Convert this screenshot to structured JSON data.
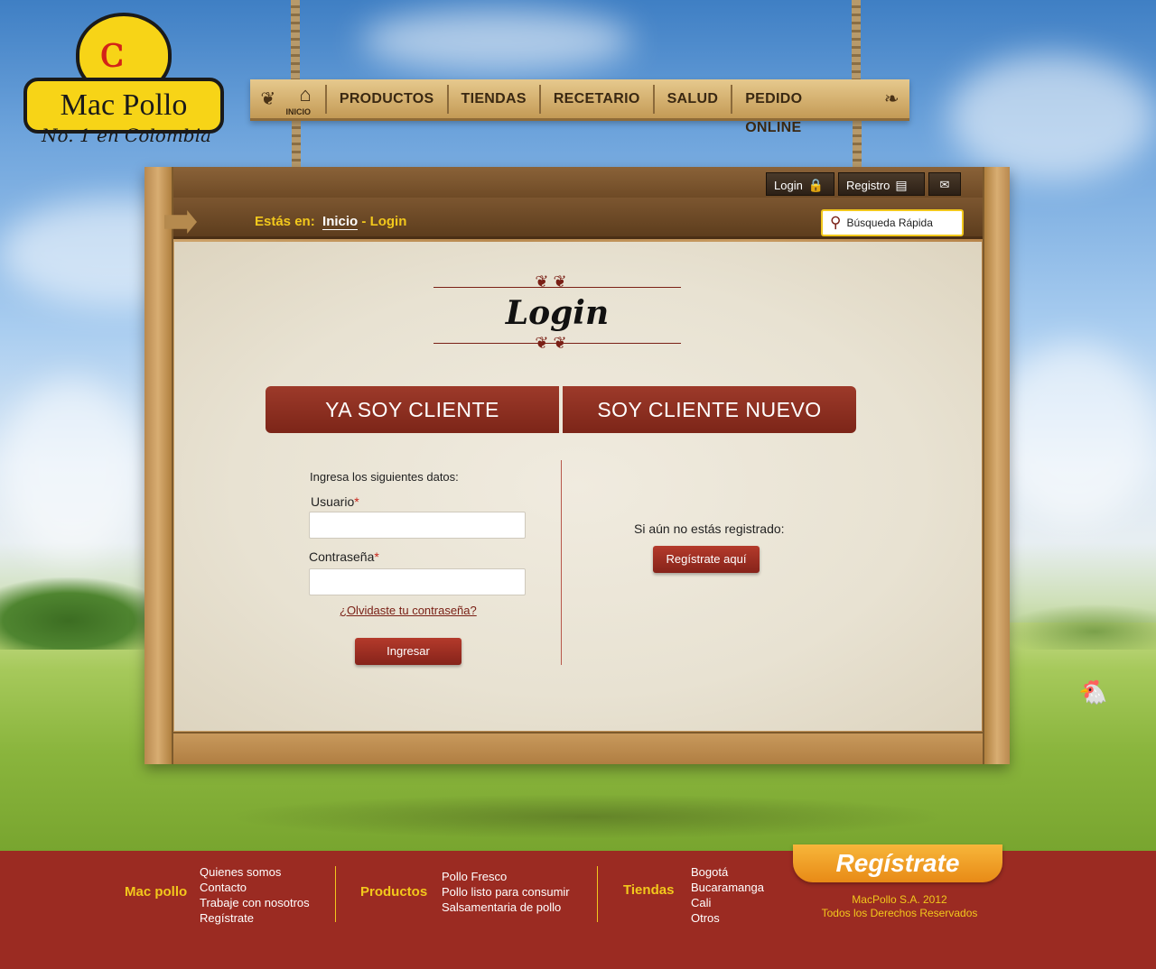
{
  "brand": {
    "name": "Mac Pollo",
    "tagline": "No. 1 en Colombia"
  },
  "nav": {
    "home_label": "INICIO",
    "items": [
      "PRODUCTOS",
      "TIENDAS",
      "RECETARIO",
      "SALUD",
      "PEDIDO ONLINE"
    ]
  },
  "topbar": {
    "login": "Login",
    "registro": "Registro"
  },
  "breadcrumb": {
    "prefix": "Estás en:",
    "home": "Inicio",
    "separator": "-",
    "current": "Login"
  },
  "search": {
    "placeholder": "Búsqueda Rápida"
  },
  "page": {
    "title": "Login"
  },
  "tabs": {
    "existing": "YA SOY CLIENTE",
    "new": "SOY CLIENTE NUEVO"
  },
  "form": {
    "intro": "Ingresa los siguientes datos:",
    "user_label": "Usuario",
    "password_label": "Contraseña",
    "required_mark": "*",
    "user_value": "",
    "password_value": "",
    "forgot": "¿Olvidaste tu contraseña?",
    "submit": "Ingresar"
  },
  "register": {
    "note": "Si aún no estás registrado:",
    "button": "Regístrate aquí"
  },
  "footer": {
    "col1": {
      "title": "Mac pollo",
      "links": [
        "Quienes somos",
        "Contacto",
        "Trabaje con nosotros",
        "Regístrate"
      ]
    },
    "col2": {
      "title": "Productos",
      "links": [
        "Pollo Fresco",
        "Pollo listo para consumir",
        "Salsamentaria de pollo"
      ]
    },
    "col3": {
      "title": "Tiendas",
      "links": [
        "Bogotá",
        "Bucaramanga",
        "Cali",
        "Otros"
      ]
    },
    "register_tab": "Regístrate",
    "copyright_line1": "MacPollo S.A. 2012",
    "copyright_line2": "Todos los  Derechos Reservados"
  },
  "colors": {
    "accent_red": "#9b2b22",
    "accent_yellow": "#f2c81c",
    "wood": "#c79a60"
  }
}
